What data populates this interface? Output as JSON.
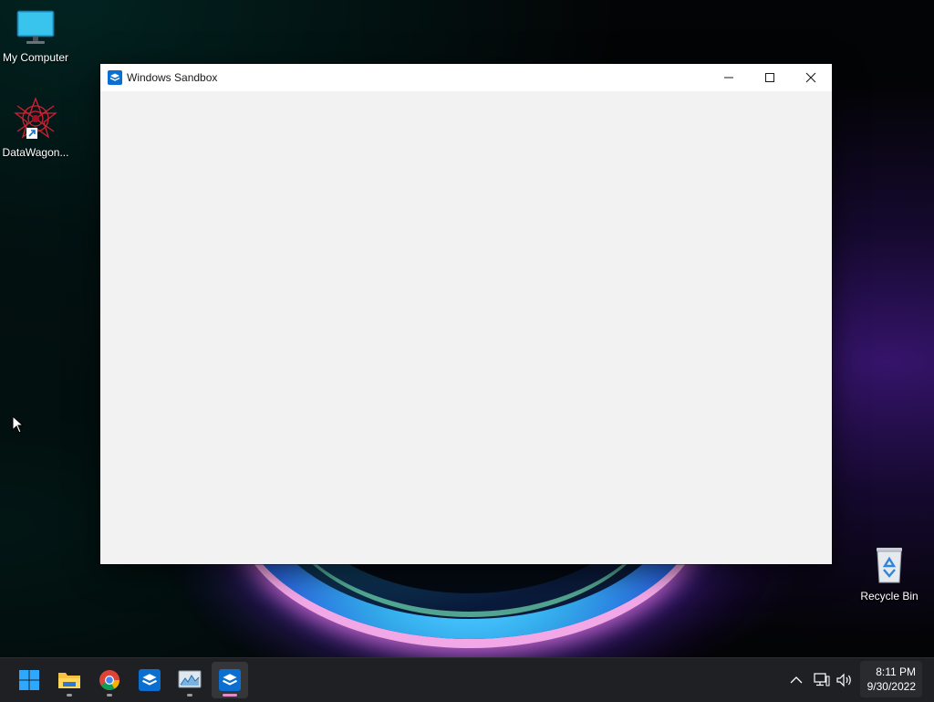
{
  "desktop": {
    "icons": [
      {
        "name": "my-computer",
        "label": "My Computer",
        "icon": "monitor-icon"
      },
      {
        "name": "datawagon",
        "label": "DataWagon...",
        "icon": "datawagon-shortcut-icon"
      },
      {
        "name": "recycle-bin",
        "label": "Recycle Bin",
        "icon": "recycle-bin-icon"
      }
    ]
  },
  "window": {
    "title": "Windows Sandbox",
    "icon": "sandbox-icon",
    "controls": [
      "minimize",
      "maximize",
      "close"
    ],
    "client_background": "#f2f2f2"
  },
  "taskbar": {
    "pinned": [
      {
        "name": "start",
        "icon": "windows-start-icon"
      },
      {
        "name": "file-explorer",
        "icon": "folder-icon"
      },
      {
        "name": "chrome",
        "icon": "chrome-icon"
      },
      {
        "name": "windows-sandbox-pinned",
        "icon": "sandbox-icon"
      },
      {
        "name": "performance-monitor",
        "icon": "chart-monitor-icon"
      },
      {
        "name": "windows-sandbox-running",
        "icon": "sandbox-icon",
        "active": true
      }
    ],
    "tray": [
      "chevron-up-icon",
      "network-icon",
      "volume-icon"
    ],
    "clock": {
      "time": "8:11 PM",
      "date": "9/30/2022"
    }
  },
  "colors": {
    "taskbar": "#1f2023",
    "accent_indicator": "#e08dc7",
    "sandbox_blue": "#0a6fd1"
  }
}
